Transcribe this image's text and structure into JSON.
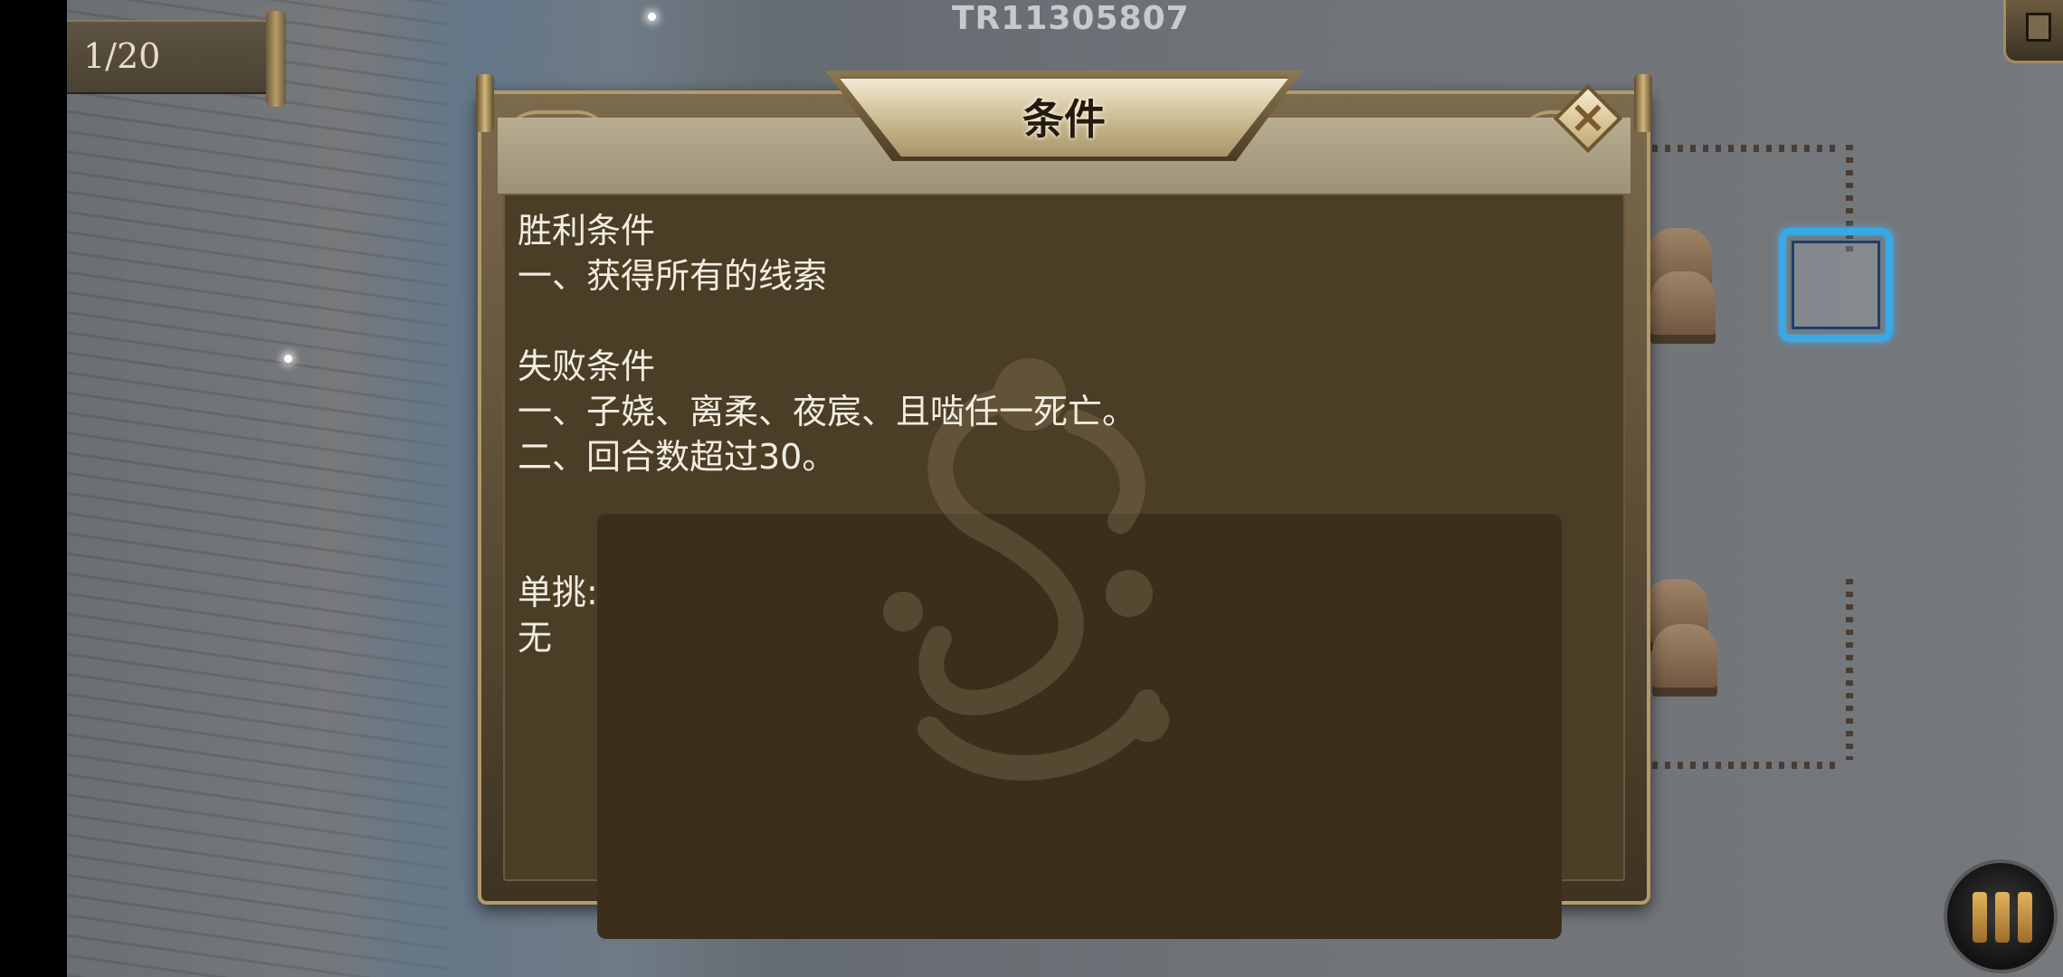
{
  "hud": {
    "turn_counter": "1/20",
    "stage_code": "TR11305807"
  },
  "dialog": {
    "title": "条件",
    "close_label": "×",
    "lines": [
      "胜利条件",
      "一、获得所有的线索",
      "",
      "失败条件",
      "一、子娆、离柔、夜宸、且啮任一死亡。",
      "二、回合数超过30。",
      "",
      "",
      "单挑:",
      "无"
    ]
  },
  "icons": {
    "close": "close-icon",
    "menu": "menu-icon",
    "dragon": "dragon-emblem-icon",
    "top_right": "minimap-icon"
  },
  "colors": {
    "cursor": "#39a9e6",
    "panel": "#4b3e26",
    "menu_accent": "#e3b35c"
  }
}
